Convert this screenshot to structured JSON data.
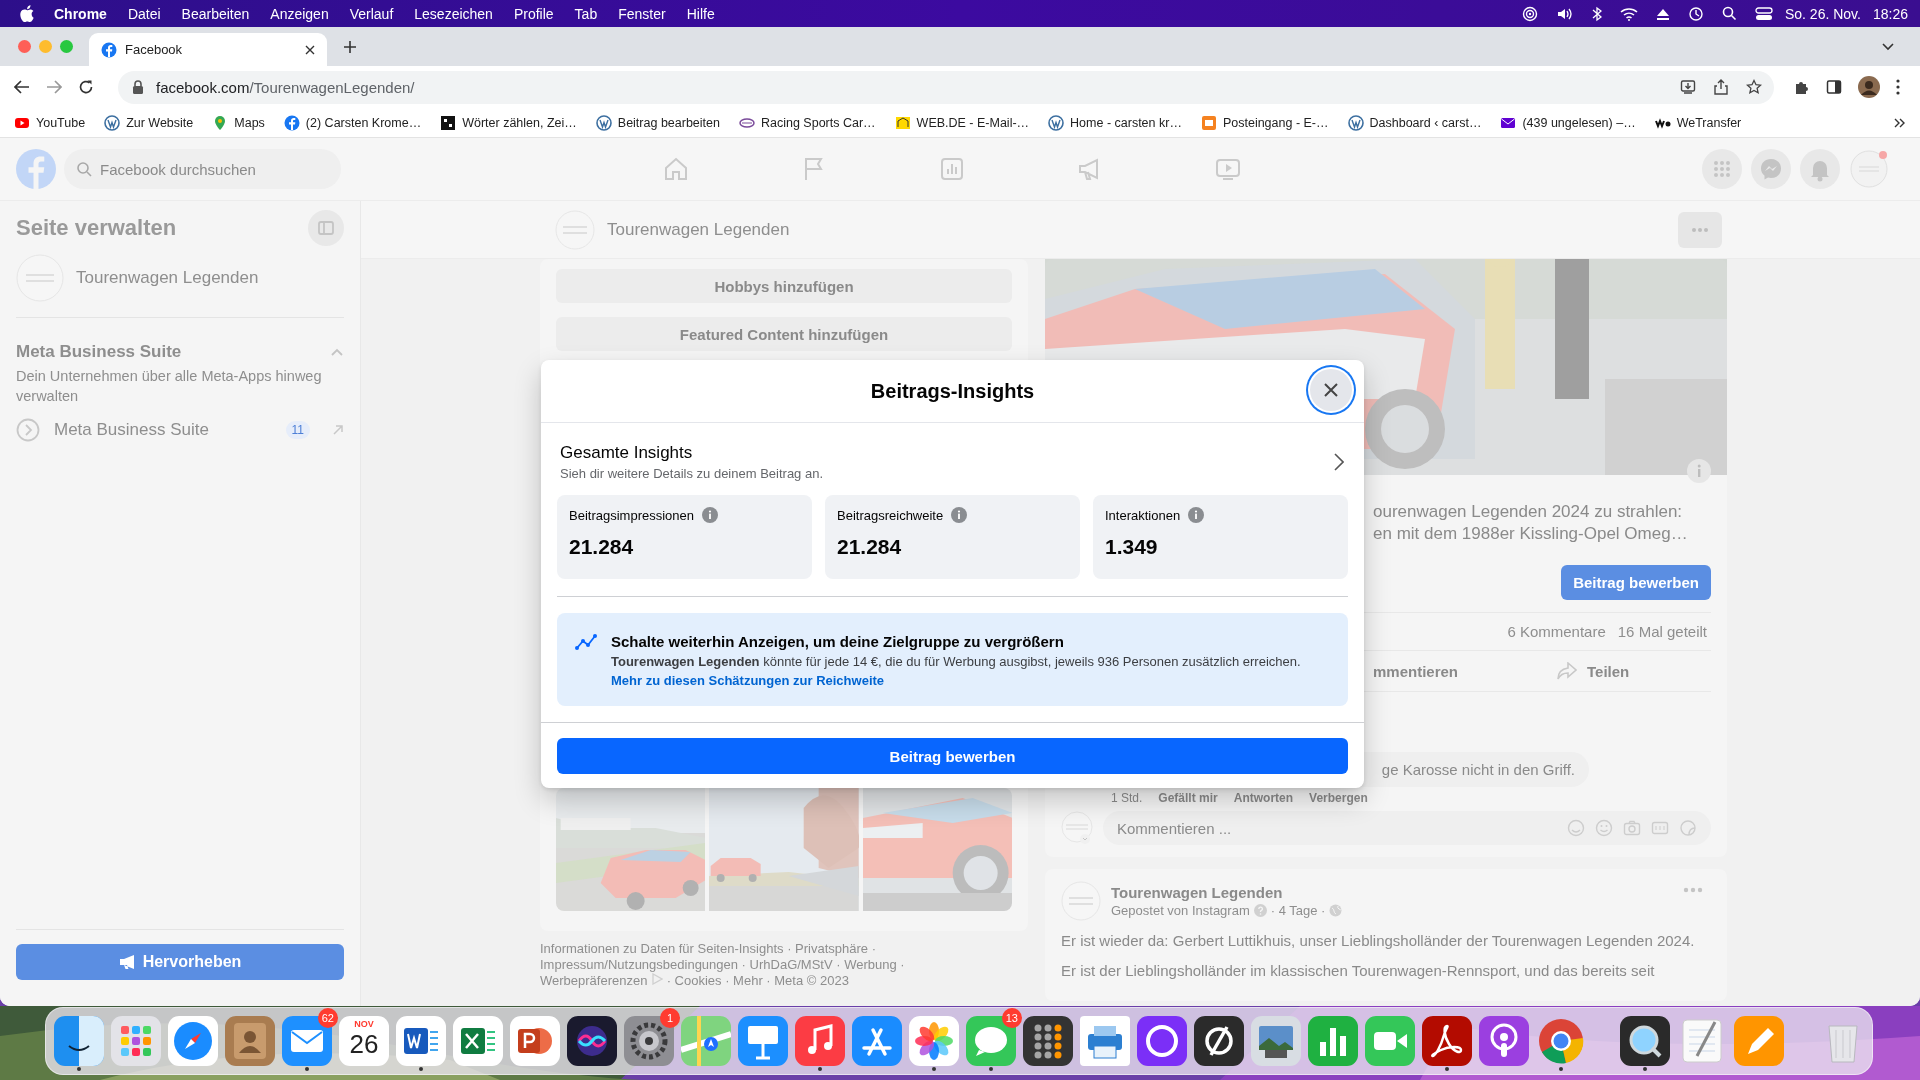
{
  "menubar": {
    "app": "Chrome",
    "menus": [
      "Datei",
      "Bearbeiten",
      "Anzeigen",
      "Verlauf",
      "Lesezeichen",
      "Profile",
      "Tab",
      "Fenster",
      "Hilfe"
    ],
    "date": "So. 26. Nov.",
    "time": "18:26"
  },
  "browser": {
    "tab": {
      "title": "Facebook",
      "selected": true
    },
    "url_host": "facebook.com",
    "url_path": "/TourenwagenLegenden/",
    "bookmarks": [
      {
        "kind": "youtube",
        "label": "YouTube"
      },
      {
        "kind": "wordpress",
        "label": "Zur Website"
      },
      {
        "kind": "maps",
        "label": "Maps"
      },
      {
        "kind": "facebook",
        "label": "(2) Carsten Krome…"
      },
      {
        "kind": "wordcount",
        "label": "Wörter zählen, Zei…"
      },
      {
        "kind": "wordpress",
        "label": "Beitrag bearbeiten"
      },
      {
        "kind": "racing",
        "label": "Racing Sports Car…"
      },
      {
        "kind": "webde",
        "label": "WEB.DE - E-Mail-…"
      },
      {
        "kind": "wordpress",
        "label": "Home - carsten kr…"
      },
      {
        "kind": "inbox",
        "label": "Posteingang - E-…"
      },
      {
        "kind": "wordpress",
        "label": "Dashboard ‹ carst…"
      },
      {
        "kind": "mail",
        "label": "(439 ungelesen) –…"
      },
      {
        "kind": "wetransfer",
        "label": "WeTransfer"
      }
    ]
  },
  "facebook": {
    "search_placeholder": "Facebook durchsuchen"
  },
  "sidebar": {
    "title": "Seite verwalten",
    "page_name": "Tourenwagen Legenden",
    "section": {
      "title": "Meta Business Suite",
      "expanded": true,
      "description": "Dein Unternehmen über alle Meta-Apps hinweg verwalten",
      "item": {
        "label": "Meta Business Suite",
        "badge": "11"
      }
    },
    "promote_button": "Hervorheben"
  },
  "page_header": {
    "name": "Tourenwagen Legenden"
  },
  "center": {
    "buttons": [
      "Hobbys hinzufügen",
      "Featured Content hinzufügen"
    ],
    "footer_before_icon": "Informationen zu Daten für Seiten-Insights · Privatsphäre · Impressum/Nutzungsbedingungen · UrhDaG/MStV · Werbung · Werbepräferenzen",
    "footer_after_icon": "· Cookies · Mehr · Meta © 2023"
  },
  "post": {
    "text_lines": [
      "ourenwagen Legenden 2024 zu strahlen:",
      "en mit dem 1988er Kissling-Opel Omeg…"
    ],
    "promote_button": "Beitrag bewerben",
    "comments_count": "6 Kommentare",
    "shares_count": "16 Mal geteilt",
    "comment_action": "mmentieren",
    "share_action": "Teilen",
    "comment": {
      "text": "ge Karosse nicht in den Griff.",
      "time": "1 Std.",
      "actions": [
        "Gefällt mir",
        "Antworten",
        "Verbergen"
      ]
    },
    "comment_placeholder": "Kommentieren ..."
  },
  "next_post": {
    "author": "Tourenwagen Legenden",
    "source": "Gepostet von Instagram",
    "age": "· 4 Tage ·",
    "paragraphs": [
      "Er ist wieder da: Gerbert Luttikhuis, unser Lieblingsholländer der Tourenwagen Legenden 2024.",
      "Er ist der Lieblingsholländer im klassischen Tourenwagen-Rennsport, und das bereits seit"
    ]
  },
  "modal": {
    "title": "Beitrags-Insights",
    "close_focused": true,
    "summary": {
      "title": "Gesamte Insights",
      "subtitle": "Sieh dir weitere Details zu deinem Beitrag an."
    },
    "metrics": [
      {
        "label": "Beitragsimpressionen",
        "value": "21.284"
      },
      {
        "label": "Beitragsreichweite",
        "value": "21.284"
      },
      {
        "label": "Interaktionen",
        "value": "1.349"
      }
    ],
    "tip": {
      "title": "Schalte weiterhin Anzeigen, um deine Zielgruppe zu vergrößern",
      "text": "**Tourenwagen Legenden** könnte für jede 14 €, die du für Werbung ausgibst, jeweils 936 Personen zusätzlich erreichen.",
      "link": "Mehr zu diesen Schätzungen zur Reichweite"
    },
    "primary_button": "Beitrag bewerben"
  },
  "dock": {
    "mail_badge": "62",
    "calendar_month": "NOV",
    "calendar_day": "26",
    "settings_badge": "1",
    "messages_badge": "13"
  }
}
